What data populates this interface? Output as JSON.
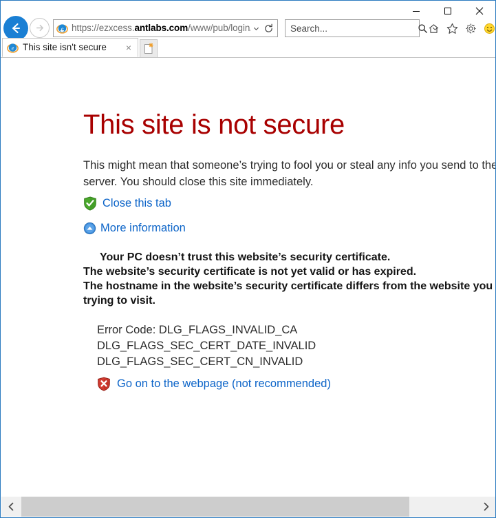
{
  "window": {
    "controls": {
      "minimize": "Minimize",
      "maximize": "Maximize",
      "close": "Close"
    }
  },
  "toolbar": {
    "back": "Back",
    "forward": "Forward",
    "url": {
      "scheme": "https://",
      "subdomain": "ezxcess.",
      "host": "antlabs.com",
      "path": "/www/pub/login/",
      "redacted": true
    },
    "url_full": "https://ezxcess.antlabs.com/www/pub/login/",
    "dropdown": "Address dropdown",
    "refresh": "Refresh",
    "icons": {
      "home": "home-icon",
      "favorites": "favorites-star-icon",
      "tools": "gear-icon",
      "feedback": "smiley-icon"
    }
  },
  "search": {
    "placeholder": "Search...",
    "value": "",
    "submit": "search-icon",
    "dropdown": "search-provider-dropdown"
  },
  "tabs": {
    "items": [
      {
        "title": "This site isn't secure",
        "favicon": "ie-icon",
        "close": "×"
      }
    ],
    "new_tab": "New tab"
  },
  "page": {
    "title": "This site is not secure",
    "body": "This might mean that someone’s trying to fool you or steal any info you send to the server. You should close this site immediately.",
    "links": {
      "close_tab": "Close this tab",
      "more_information": "More information",
      "go_on": "Go on to the webpage (not recommended)"
    },
    "details": [
      "Your PC doesn’t trust this website’s security certificate.",
      "The website’s security certificate is not yet valid or has expired.",
      "The hostname in the website’s security certificate differs from the website you are trying to visit."
    ],
    "error_codes": [
      "Error Code: DLG_FLAGS_INVALID_CA",
      "DLG_FLAGS_SEC_CERT_DATE_INVALID",
      "DLG_FLAGS_SEC_CERT_CN_INVALID"
    ],
    "colors": {
      "title": "#a80000",
      "link": "#0c64c8",
      "text": "#2b2b2b",
      "accent": "#1a7fd4"
    }
  },
  "scrollbar": {
    "left_arrow": "‹",
    "right_arrow": "›",
    "thumb_fraction": "0.85"
  }
}
